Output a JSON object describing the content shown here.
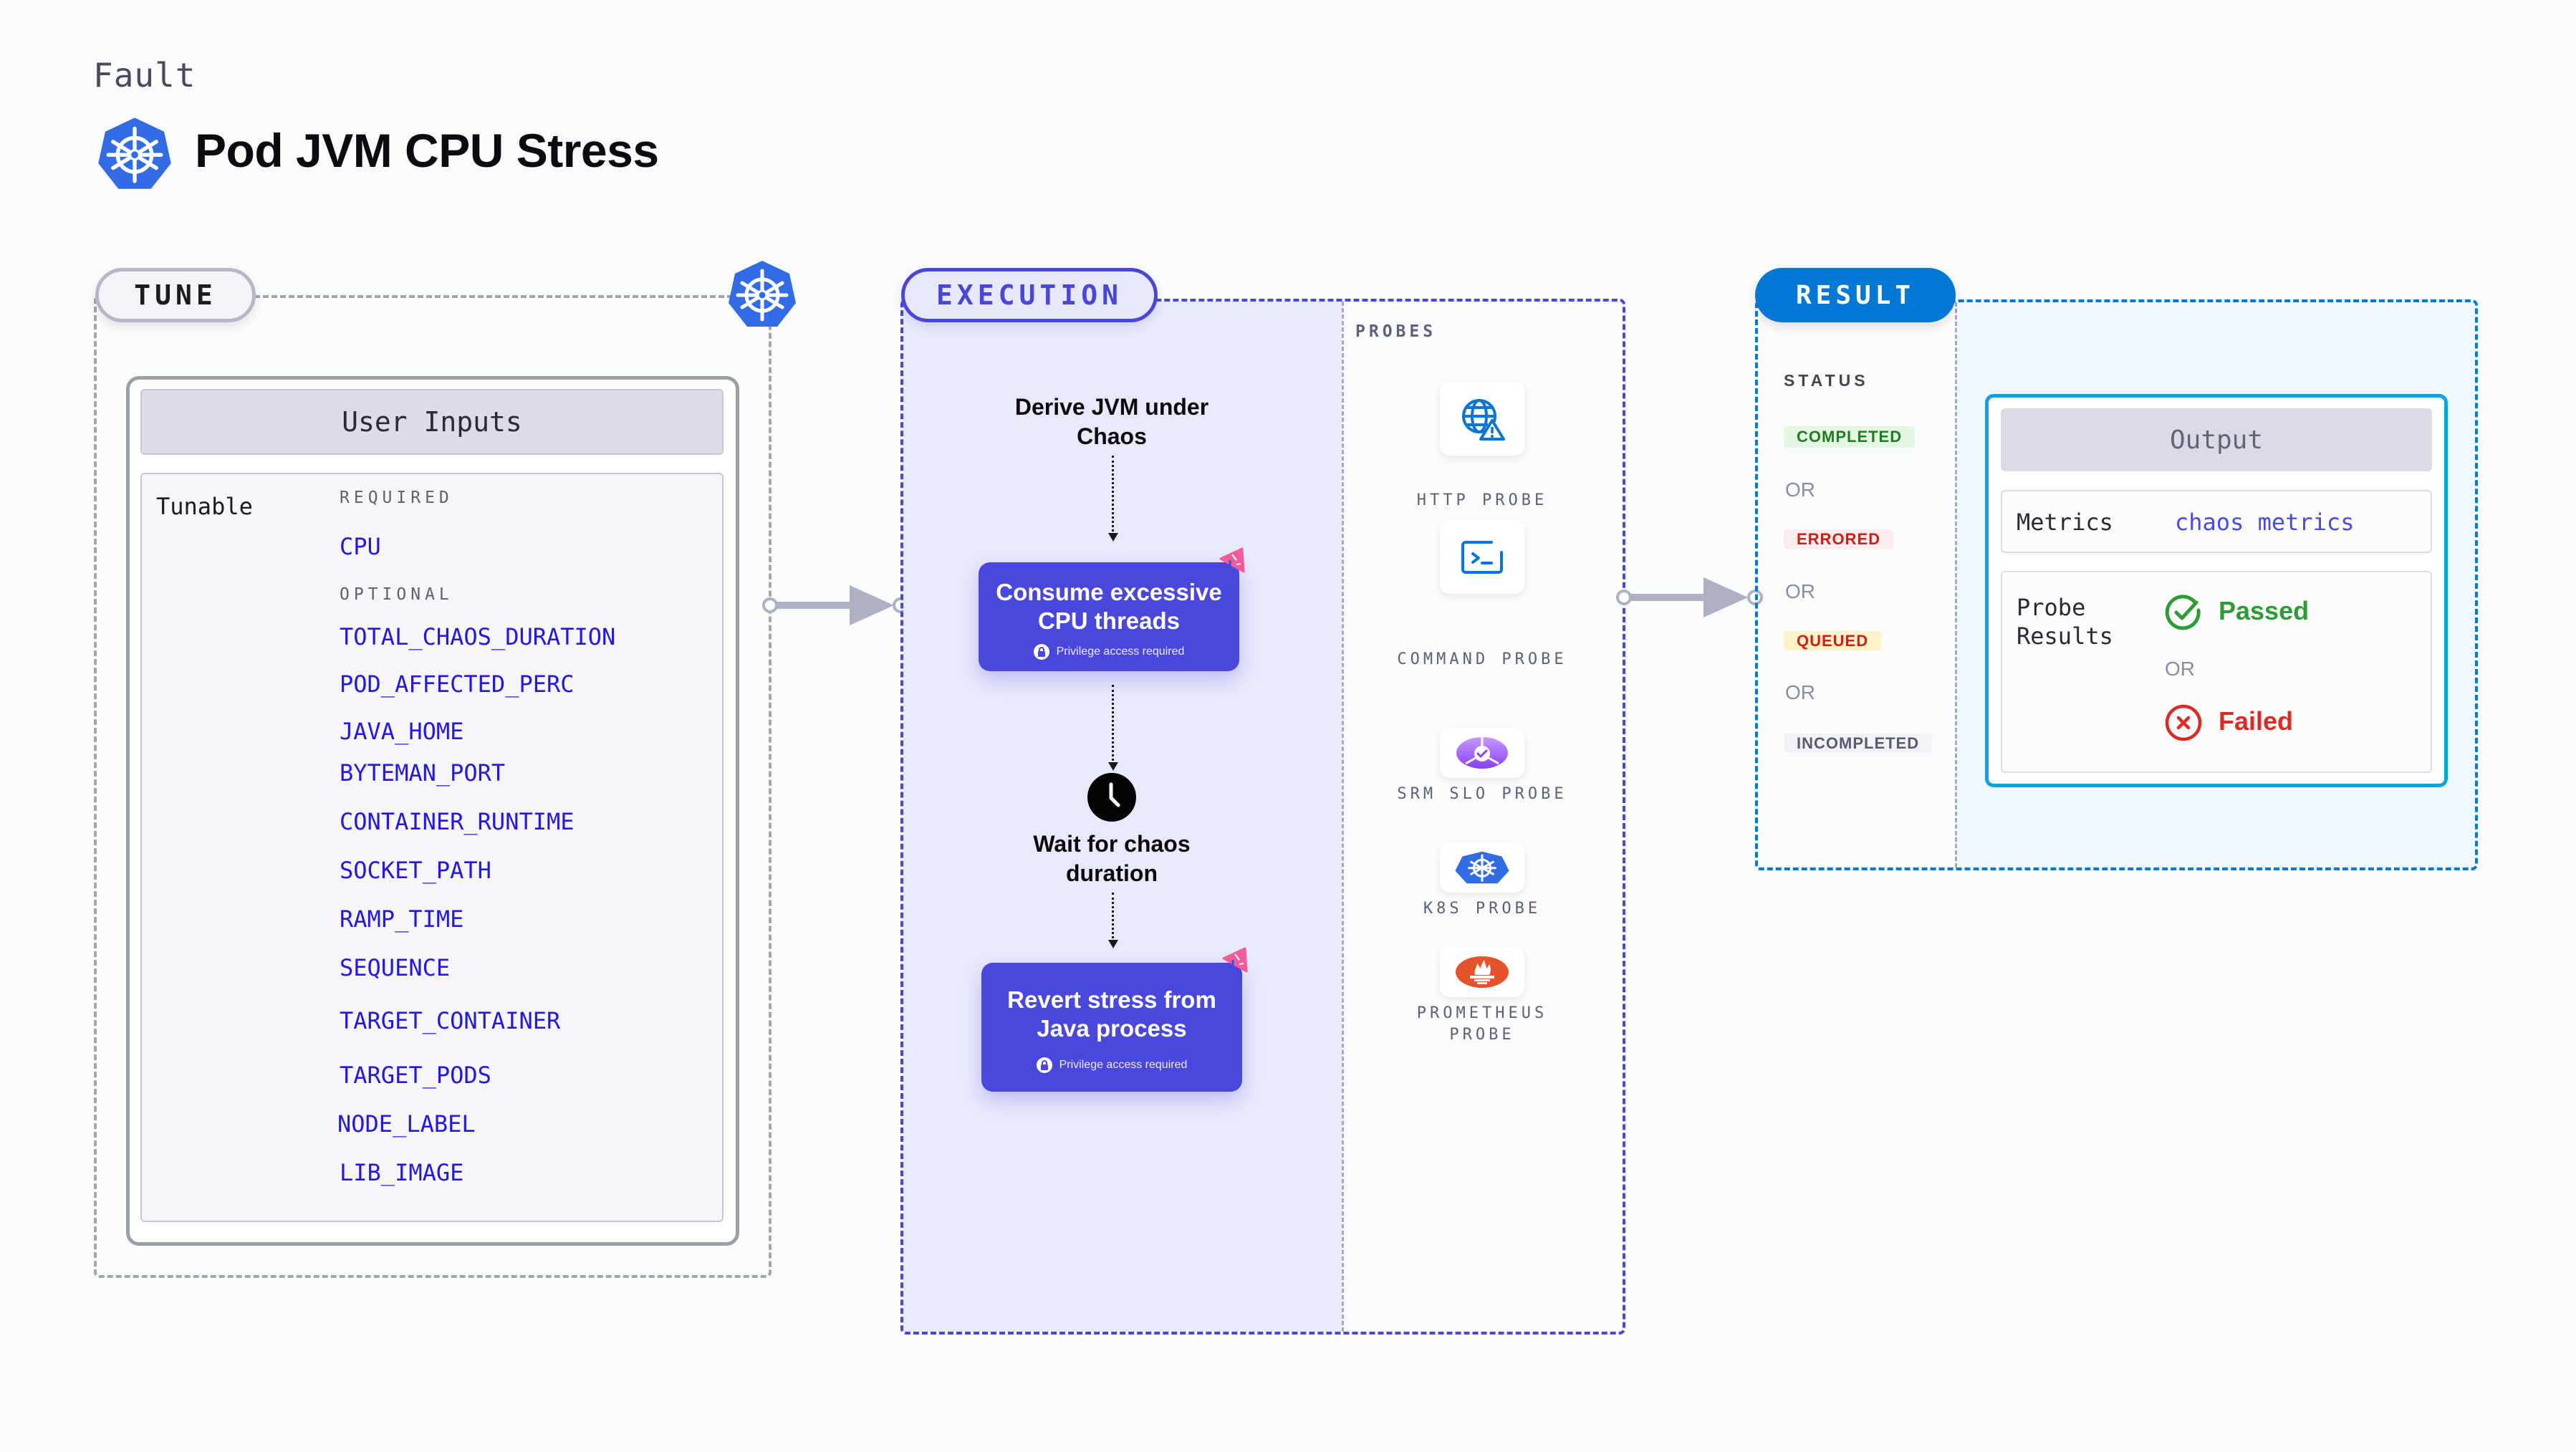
{
  "header": {
    "category": "Fault",
    "title": "Pod JVM CPU Stress",
    "title_icon": "kubernetes-icon"
  },
  "tune": {
    "label": "TUNE",
    "icon": "kubernetes-icon",
    "card_title": "User Inputs",
    "tunable_label": "Tunable",
    "required_label": "REQUIRED",
    "required": [
      "CPU"
    ],
    "optional_label": "OPTIONAL",
    "optional": [
      "TOTAL_CHAOS_DURATION",
      "POD_AFFECTED_PERC",
      "JAVA_HOME",
      "BYTEMAN_PORT",
      "CONTAINER_RUNTIME",
      "SOCKET_PATH",
      "RAMP_TIME",
      "SEQUENCE",
      "TARGET_CONTAINER",
      "TARGET_PODS",
      "NODE_LABEL",
      "LIB_IMAGE"
    ]
  },
  "execution": {
    "label": "EXECUTION",
    "steps": {
      "derive": "Derive JVM under Chaos",
      "consume": {
        "title": "Consume excessive CPU threads",
        "note": "Privilege access required"
      },
      "wait": "Wait for chaos duration",
      "revert": {
        "title": "Revert stress from Java process",
        "note": "Privilege access required"
      }
    },
    "probes_label": "PROBES",
    "probes": [
      {
        "name": "HTTP PROBE",
        "icon": "globe-warning-icon"
      },
      {
        "name": "COMMAND PROBE",
        "icon": "terminal-icon"
      },
      {
        "name": "SRM SLO PROBE",
        "icon": "slo-gauge-icon"
      },
      {
        "name": "K8S PROBE",
        "icon": "kubernetes-icon"
      },
      {
        "name": "PROMETHEUS PROBE",
        "icon": "prometheus-icon"
      }
    ]
  },
  "result": {
    "label": "RESULT",
    "status_label": "STATUS",
    "statuses": [
      {
        "text": "COMPLETED",
        "fg": "#1e7d22",
        "bg": "#e3f7e1"
      },
      {
        "text": "ERRORED",
        "fg": "#cc1f1a",
        "bg": "#fdeced"
      },
      {
        "text": "QUEUED",
        "fg": "#cc1f1a",
        "bg": "#fff4c7"
      },
      {
        "text": "INCOMPLETED",
        "fg": "#5a5a6e",
        "bg": "#f1f2f7"
      }
    ],
    "or_text": "OR",
    "output": {
      "title": "Output",
      "metrics_label": "Metrics",
      "metrics_value": "chaos metrics",
      "probe_results_label": "Probe Results",
      "passed": "Passed",
      "failed": "Failed",
      "or_text": "OR"
    }
  },
  "colors": {
    "execution_accent": "#4a47d8",
    "result_accent": "#0278d5",
    "kubernetes_blue": "#326ce5",
    "param_blue": "#2418e0"
  }
}
